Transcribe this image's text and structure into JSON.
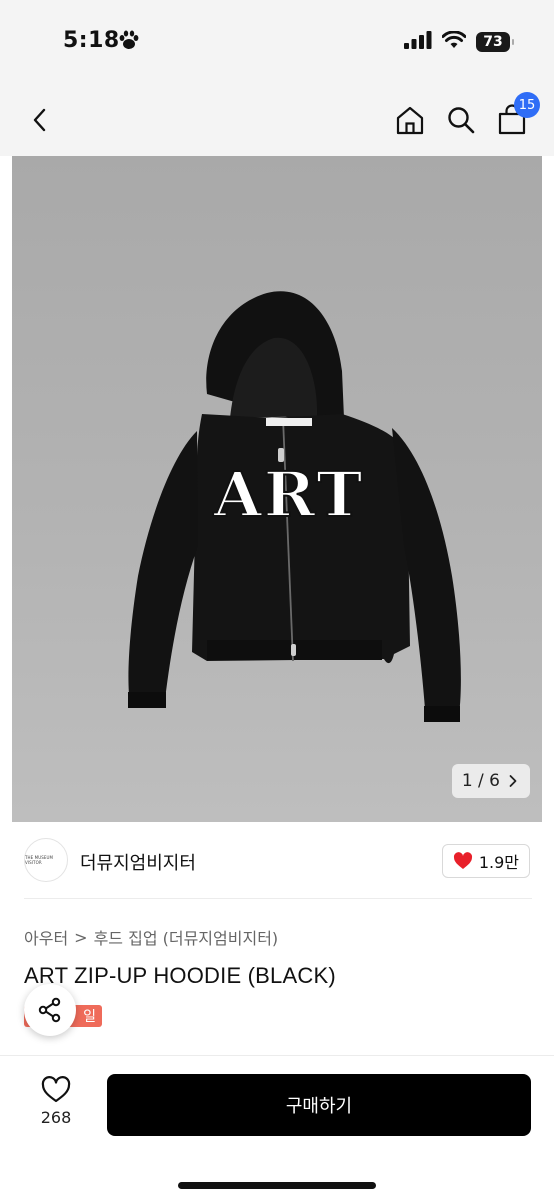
{
  "status_bar": {
    "time": "5:18",
    "battery": "73"
  },
  "header": {
    "cart_count": "15"
  },
  "gallery": {
    "image_text": "ART",
    "page_indicator": "1 / 6"
  },
  "brand": {
    "name": "더뮤지엄비지터",
    "logo_text": "THE MUSEUM VISITOR",
    "likes": "1.9만"
  },
  "product": {
    "breadcrumb_category": "아우터",
    "breadcrumb_separator": ">",
    "breadcrumb_sub": "후드 집업 (더뮤지엄비지터)",
    "title": "ART ZIP-UP HOODIE (BLACK)",
    "badge": "일"
  },
  "bottom_bar": {
    "wish_count": "268",
    "buy_label": "구매하기"
  },
  "colors": {
    "accent_blue": "#2f6df6",
    "heart_red": "#e8202a",
    "sale_badge": "#ef6b5a",
    "buy_button": "#000000"
  }
}
